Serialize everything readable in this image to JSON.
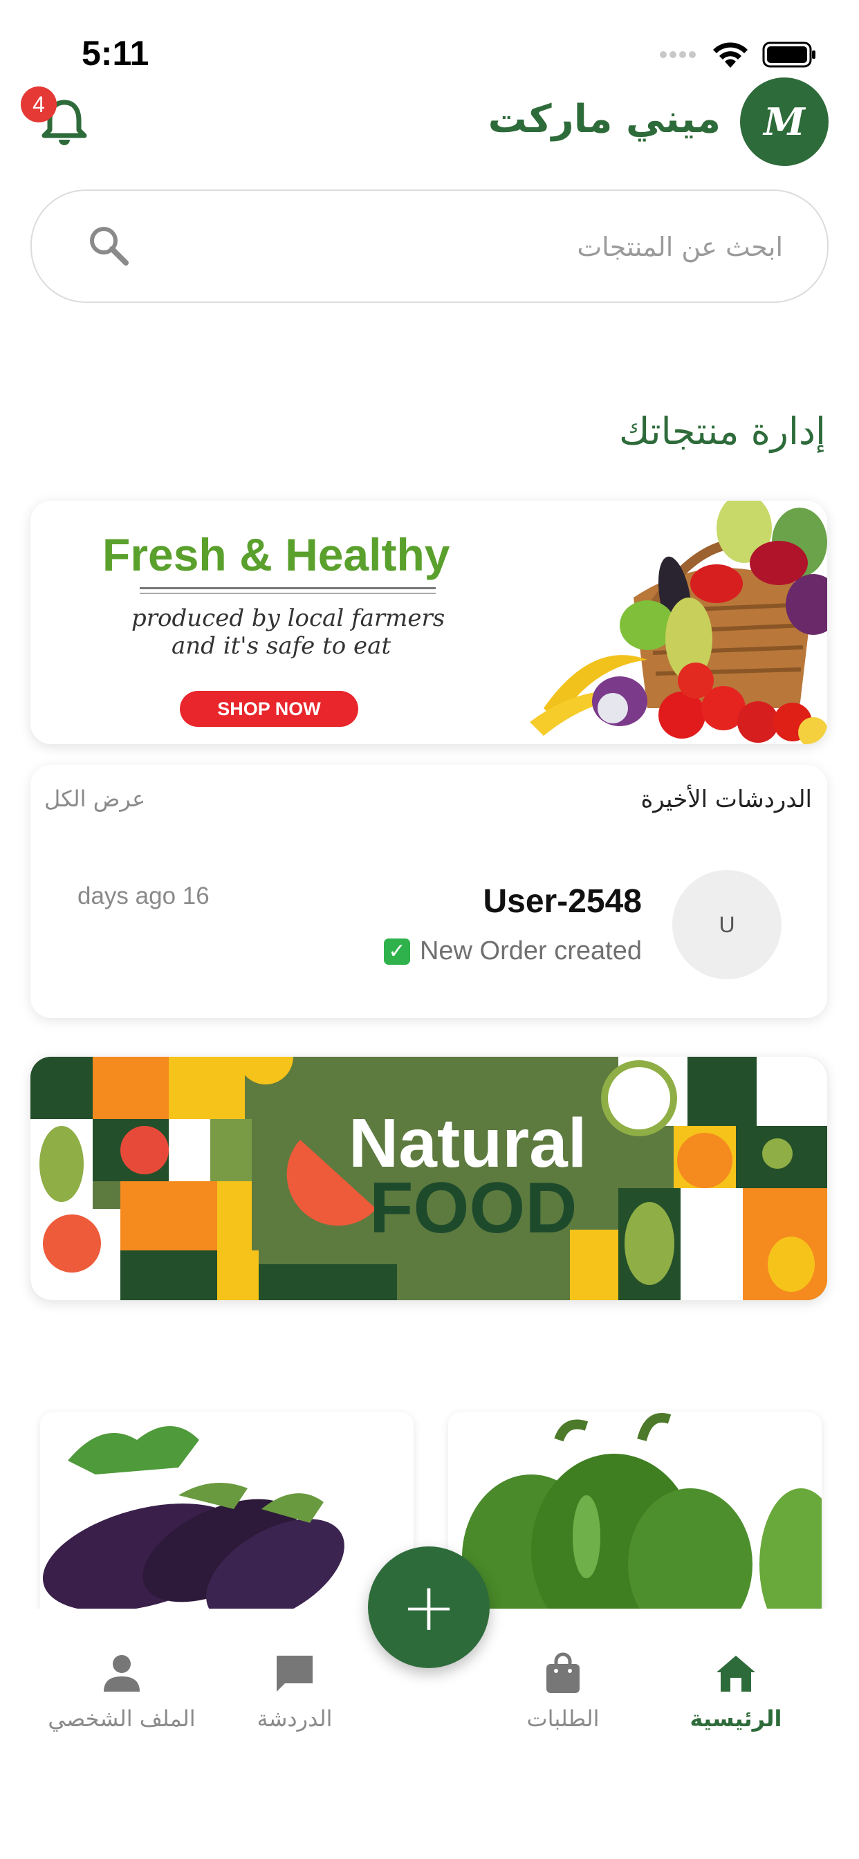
{
  "status_bar": {
    "time": "5:11"
  },
  "header": {
    "notification_count": "4",
    "brand_name": "ميني ماركت",
    "logo_text": "M"
  },
  "search": {
    "placeholder": "ابحث عن المنتجات"
  },
  "section_title": "إدارة منتجاتك",
  "banner_fresh": {
    "title": "Fresh & Healthy",
    "subtitle_line1": "produced by local farmers",
    "subtitle_line2": "and it's safe to eat",
    "button": "SHOP NOW"
  },
  "recent_chats": {
    "title": "الدردشات الأخيرة",
    "view_all": "عرض الكل",
    "items": [
      {
        "avatar_initial": "U",
        "user": "User-2548",
        "message": "New Order created",
        "time": "days ago 16"
      }
    ]
  },
  "banner_natural": {
    "title_line1": "Natural",
    "title_line2": "FOOD"
  },
  "products": [
    {
      "image": "eggplant"
    },
    {
      "image": "green-pepper"
    }
  ],
  "bottom_nav": {
    "items": [
      {
        "label": "الرئيسية",
        "icon": "home-icon",
        "active": true
      },
      {
        "label": "الطلبات",
        "icon": "shopping-bag-icon",
        "active": false
      },
      {
        "label": "الدردشة",
        "icon": "chat-icon",
        "active": false
      },
      {
        "label": "الملف الشخصي",
        "icon": "person-icon",
        "active": false
      }
    ],
    "fab_label": "+"
  },
  "colors": {
    "primary": "#2e6b3a",
    "badge": "#e53935",
    "banner_green": "#5aa02c",
    "shop_button": "#e8262c"
  }
}
